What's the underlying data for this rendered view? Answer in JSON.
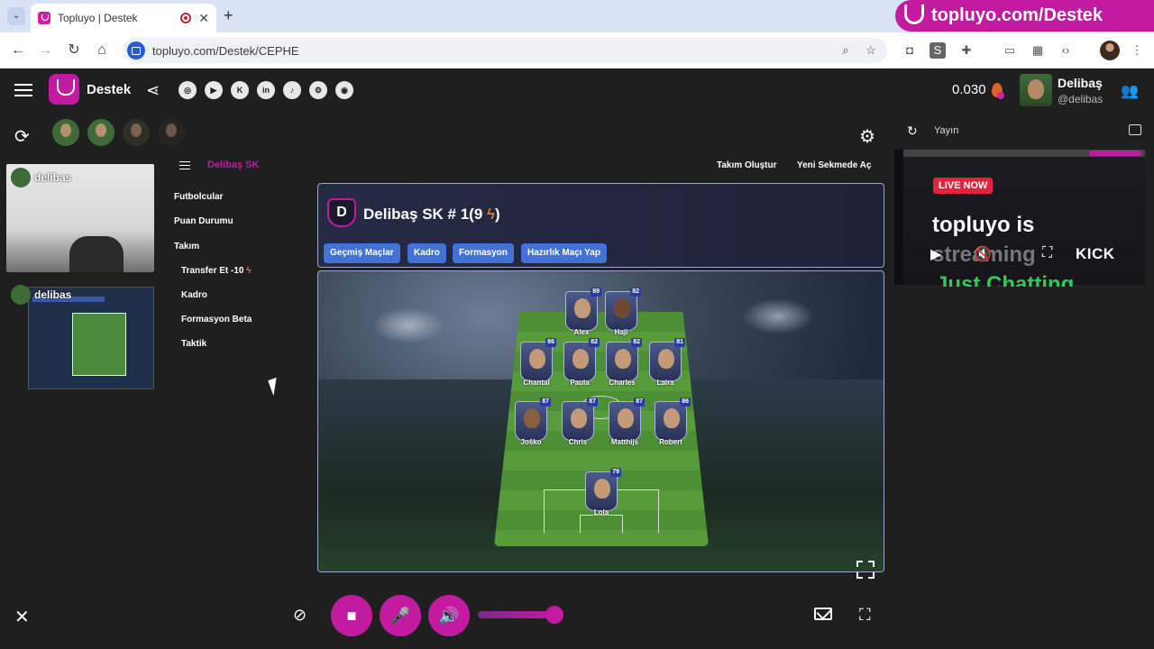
{
  "browser": {
    "tab_title": "Topluyo | Destek",
    "tab_close": "✕",
    "new_tab": "+",
    "url": "topluyo.com/Destek/CEPHE",
    "banner_text": "topluyo.com/Destek"
  },
  "header": {
    "app_name": "Destek",
    "socials": [
      "◎",
      "▶",
      "K",
      "in",
      "♪",
      "⚙",
      "◉"
    ],
    "balance": "0.030",
    "user_name": "Delibaş",
    "user_handle": "@delibas"
  },
  "tiles": [
    {
      "name": "delibas"
    },
    {
      "name": "delibas"
    }
  ],
  "sidebar": {
    "team_title": "Delibaş SK",
    "items": [
      {
        "label": "Futbolcular"
      },
      {
        "label": "Puan Durumu"
      },
      {
        "label": "Takım"
      },
      {
        "label": "Transfer Et -10"
      },
      {
        "label": "Kadro"
      },
      {
        "label": "Formasyon Beta"
      },
      {
        "label": "Taktik"
      }
    ]
  },
  "top_links": [
    "Takım Oluştur",
    "Yeni Sekmede Aç"
  ],
  "team": {
    "badge": "D",
    "title_prefix": "Delibaş SK # 1(9",
    "title_suffix": ")",
    "tabs": [
      "Geçmiş Maçlar",
      "Kadro",
      "Formasyon",
      "Hazırlık Maçı Yap"
    ]
  },
  "players": [
    {
      "name": "Alex",
      "rating": "89"
    },
    {
      "name": "Haji",
      "rating": "82"
    },
    {
      "name": "Chantal",
      "rating": "86"
    },
    {
      "name": "Paula",
      "rating": "82"
    },
    {
      "name": "Charles",
      "rating": "82"
    },
    {
      "name": "Laira",
      "rating": "81"
    },
    {
      "name": "Joško",
      "rating": "87"
    },
    {
      "name": "Chris",
      "rating": "87"
    },
    {
      "name": "Matthijs",
      "rating": "87"
    },
    {
      "name": "Robert",
      "rating": "86"
    },
    {
      "name": "Lola",
      "rating": "79"
    }
  ],
  "stream": {
    "label": "Yayın",
    "live": "LIVE NOW",
    "line1": "topluyo is",
    "line2": "streaming",
    "line3": "Just Chatting",
    "platform": "KICK"
  },
  "colors": {
    "brand": "#c21aa0",
    "tab_button": "#4372d6",
    "live": "#e2233d"
  }
}
